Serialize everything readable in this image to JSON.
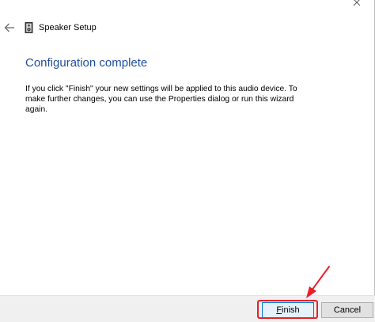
{
  "window": {
    "title": "Speaker Setup",
    "close_icon": "close-icon",
    "back_icon": "back-arrow-icon",
    "app_icon": "speaker-icon"
  },
  "page": {
    "heading": "Configuration complete",
    "body": "If you click \"Finish\" your new settings will be applied to this audio device.  To make further changes, you can use the Properties dialog or run this wizard again."
  },
  "buttons": {
    "finish_mnemonic": "F",
    "finish_rest": "inish",
    "cancel_label": "Cancel"
  },
  "colors": {
    "heading": "#1f4e9c",
    "annotation": "#e8202a",
    "footer_bg": "#f0f0f0",
    "default_button_border": "#0078d7"
  }
}
